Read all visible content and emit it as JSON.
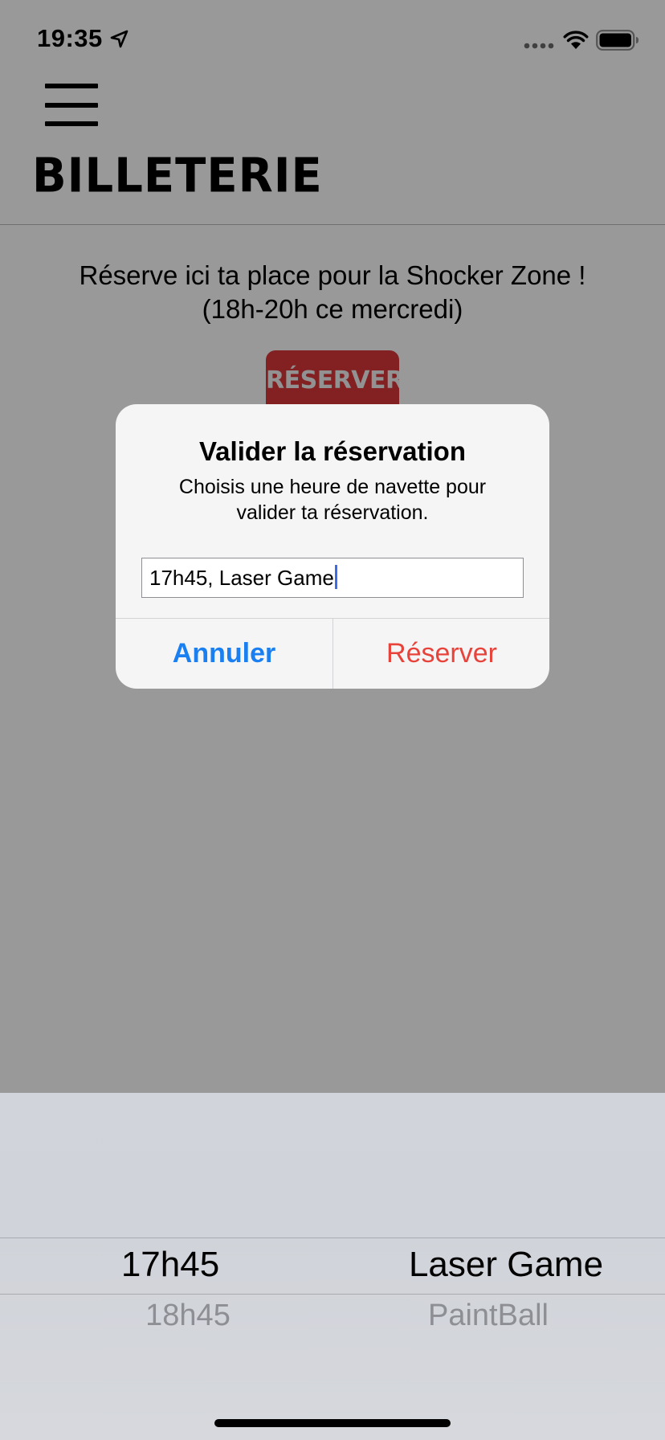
{
  "status_bar": {
    "time": "19:35",
    "icons": [
      "location-arrow-icon",
      "signal-icon",
      "wifi-icon",
      "battery-icon"
    ]
  },
  "header": {
    "menu_icon": "hamburger-icon",
    "title": "BILLETERIE"
  },
  "main": {
    "intro_line1": "Réserve ici ta place pour la Shocker Zone !",
    "intro_line2": "(18h-20h ce mercredi)",
    "reserve_image_label": "RÉSERVER",
    "reserve_image_color": "#d93639"
  },
  "alert": {
    "title": "Valider la réservation",
    "message_line1": "Choisis une heure de navette pour",
    "message_line2": "valider ta réservation.",
    "input_value": "17h45, Laser Game",
    "cancel_label": "Annuler",
    "confirm_label": "Réserver",
    "cancel_color": "#1a7ff0",
    "confirm_color": "#e8433b"
  },
  "picker": {
    "columns": [
      {
        "selected": "17h45",
        "next": "18h45"
      },
      {
        "selected": "Laser Game",
        "next": "PaintBall"
      }
    ]
  }
}
